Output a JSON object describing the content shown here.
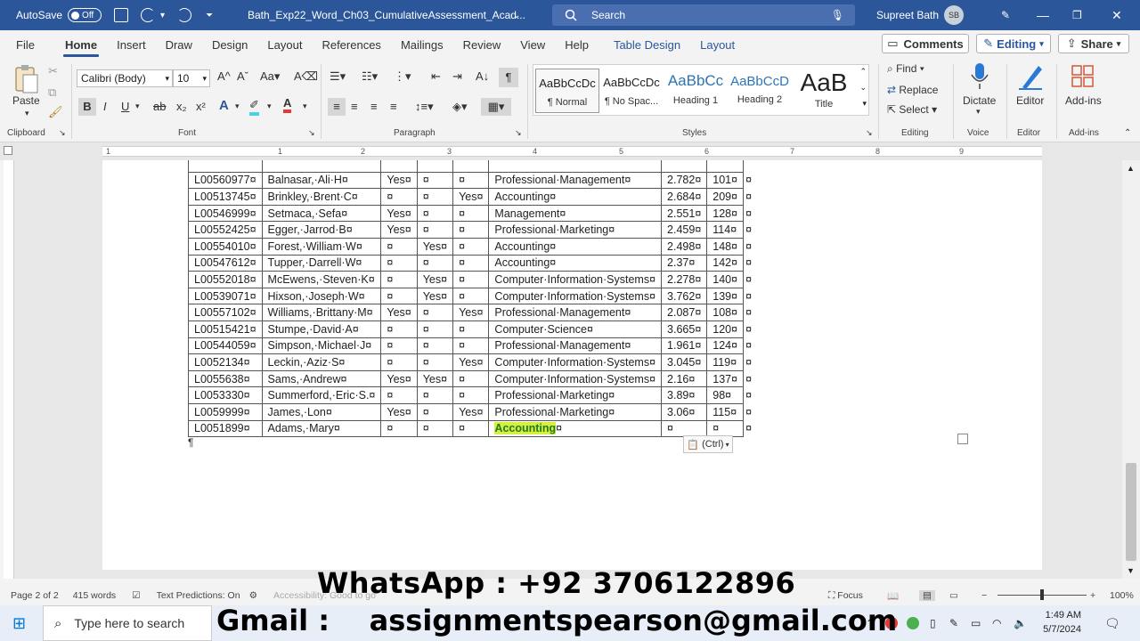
{
  "titlebar": {
    "autosave_label": "AutoSave",
    "autosave_state": "Off",
    "doc_title": "Bath_Exp22_Word_Ch03_CumulativeAssessment_Acad...",
    "search_placeholder": "Search",
    "user_name": "Supreet Bath",
    "user_initials": "SB"
  },
  "menu": {
    "items": [
      "File",
      "Home",
      "Insert",
      "Draw",
      "Design",
      "Layout",
      "References",
      "Mailings",
      "Review",
      "View",
      "Help",
      "Table Design",
      "Layout"
    ],
    "comments_label": "Comments",
    "editing_label": "Editing",
    "share_label": "Share"
  },
  "ribbon": {
    "clipboard": {
      "paste_label": "Paste",
      "group_label": "Clipboard"
    },
    "font": {
      "font_name": "Calibri (Body)",
      "font_size": "10",
      "group_label": "Font"
    },
    "paragraph": {
      "group_label": "Paragraph"
    },
    "styles": {
      "group_label": "Styles",
      "tiles": [
        {
          "preview": "AaBbCcDc",
          "name": "¶ Normal"
        },
        {
          "preview": "AaBbCcDc",
          "name": "¶ No Spac..."
        },
        {
          "preview": "AaBbCc",
          "name": "Heading 1"
        },
        {
          "preview": "AaBbCcD",
          "name": "Heading 2"
        },
        {
          "preview": "AaB",
          "name": "Title"
        }
      ]
    },
    "editing": {
      "find": "Find",
      "replace": "Replace",
      "select": "Select",
      "group_label": "Editing"
    },
    "voice": {
      "dictate": "Dictate",
      "group_label": "Voice"
    },
    "editor": {
      "label": "Editor",
      "group_label": "Editor"
    },
    "addins": {
      "label": "Add-ins",
      "group_label": "Add-ins"
    }
  },
  "ruler": {
    "marks": [
      "1",
      "1",
      "2",
      "3",
      "4",
      "5",
      "6",
      "7",
      "8",
      "9"
    ]
  },
  "table": {
    "rows": [
      [
        "L00560977¤",
        "Balnasar,·Ali·H¤",
        "Yes¤",
        "¤",
        "¤",
        "Professional·Management¤",
        "2.782¤",
        "101¤",
        "¤"
      ],
      [
        "L00513745¤",
        "Brinkley,·Brent·C¤",
        "¤",
        "¤",
        "Yes¤",
        "Accounting¤",
        "2.684¤",
        "209¤",
        "¤"
      ],
      [
        "L00546999¤",
        "Setmaca,·Sefa¤",
        "Yes¤",
        "¤",
        "¤",
        "Management¤",
        "2.551¤",
        "128¤",
        "¤"
      ],
      [
        "L00552425¤",
        "Egger,·Jarrod·B¤",
        "Yes¤",
        "¤",
        "¤",
        "Professional·Marketing¤",
        "2.459¤",
        "114¤",
        "¤"
      ],
      [
        "L00554010¤",
        "Forest,·William·W¤",
        "¤",
        "Yes¤",
        "¤",
        "Accounting¤",
        "2.498¤",
        "148¤",
        "¤"
      ],
      [
        "L00547612¤",
        "Tupper,·Darrell·W¤",
        "¤",
        "¤",
        "¤",
        "Accounting¤",
        "2.37¤",
        "142¤",
        "¤"
      ],
      [
        "L00552018¤",
        "McEwens,·Steven·K¤",
        "¤",
        "Yes¤",
        "¤",
        "Computer·Information·Systems¤",
        "2.278¤",
        "140¤",
        "¤"
      ],
      [
        "L00539071¤",
        "Hixson,·Joseph·W¤",
        "¤",
        "Yes¤",
        "¤",
        "Computer·Information·Systems¤",
        "3.762¤",
        "139¤",
        "¤"
      ],
      [
        "L00557102¤",
        "Williams,·Brittany·M¤",
        "Yes¤",
        "¤",
        "Yes¤",
        "Professional·Management¤",
        "2.087¤",
        "108¤",
        "¤"
      ],
      [
        "L00515421¤",
        "Stumpe,·David·A¤",
        "¤",
        "¤",
        "¤",
        "Computer·Science¤",
        "3.665¤",
        "120¤",
        "¤"
      ],
      [
        "L00544059¤",
        "Simpson,·Michael·J¤",
        "¤",
        "¤",
        "¤",
        "Professional·Management¤",
        "1.961¤",
        "124¤",
        "¤"
      ],
      [
        "L0052134¤",
        "Leckin,·Aziz·S¤",
        "¤",
        "¤",
        "Yes¤",
        "Computer·Information·Systems¤",
        "3.045¤",
        "119¤",
        "¤"
      ],
      [
        "L0055638¤",
        "Sams,·Andrew¤",
        "Yes¤",
        "Yes¤",
        "¤",
        "Computer·Information·Systems¤",
        "2.16¤",
        "137¤",
        "¤"
      ],
      [
        "L0053330¤",
        "Summerford,·Eric·S.¤",
        "¤",
        "¤",
        "¤",
        "Professional·Marketing¤",
        "3.89¤",
        "98¤",
        "¤"
      ],
      [
        "L0059999¤",
        "James,·Lon¤",
        "Yes¤",
        "¤",
        "Yes¤",
        "Professional·Marketing¤",
        "3.06¤",
        "115¤",
        "¤"
      ]
    ],
    "last_row": {
      "id": "L0051899¤",
      "name": "Adams,·Mary¤",
      "c1": "¤",
      "c2": "¤",
      "c3": "¤",
      "major": "Accounting",
      "major_mark": "¤",
      "gpa": "¤",
      "credits": "¤",
      "end": "¤"
    }
  },
  "doc": {
    "pilcrow": "¶",
    "paste_options": "(Ctrl)"
  },
  "statusbar": {
    "page": "Page 2 of 2",
    "words": "415 words",
    "text_predictions": "Text Predictions: On",
    "accessibility": "Accessibility: Good to go",
    "focus": "Focus",
    "zoom": "100%"
  },
  "taskbar": {
    "search_placeholder": "Type here to search",
    "time": "1:49 AM",
    "date": "5/7/2024"
  },
  "overlay": {
    "whatsapp": "WhatsApp :  +92 3706122896",
    "gmail": "Gmail :    assignmentspearson@gmail.com"
  }
}
